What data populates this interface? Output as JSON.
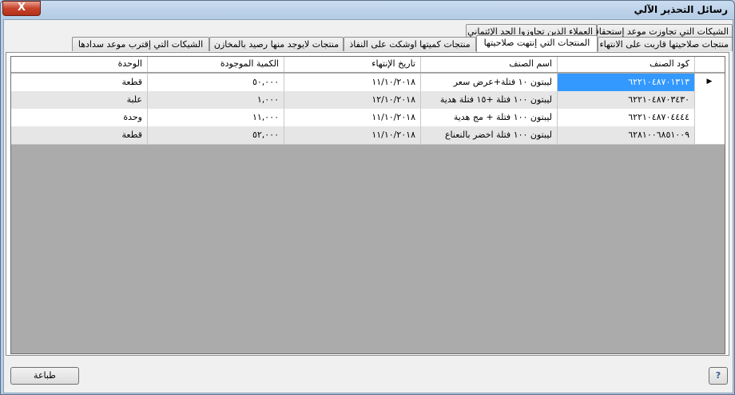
{
  "window": {
    "title": "رسائل التحذير الآلي",
    "close_label": "X"
  },
  "tabs_back": [
    {
      "label": "الشيكات التي تجاوزت موعد إستحقاقها"
    },
    {
      "label": "العملاء الذين تجاوزوا الحد الإئتماني"
    }
  ],
  "tabs_front": [
    {
      "label": "منتجات صلاحيتها قاربت على الانتهاء"
    },
    {
      "label": "المنتجات التي إنتهت صلاحيتها",
      "active": true
    },
    {
      "label": "منتجات كميتها اوشكت على النفاذ"
    },
    {
      "label": "منتجات لايوجد منها رصيد بالمخازن"
    },
    {
      "label": "الشيكات التي إقترب موعد سدادها"
    }
  ],
  "grid": {
    "columns": [
      "كود الصنف",
      "اسم الصنف",
      "تاريخ الإنتهاء",
      "الكمية الموجودة",
      "الوحدة"
    ],
    "rows": [
      {
        "code": "٦٢٢١٠٤٨٧٠١٣١٣",
        "name": "ليبتون ١٠ فتلة+عرض سعر",
        "expiry": "١١/١٠/٢٠١٨",
        "qty": "٥٠,٠٠٠",
        "unit": "قطعة",
        "selected": true
      },
      {
        "code": "٦٢٢١٠٤٨٧٠٣٤٣٠",
        "name": "ليبتون ١٠٠ فتلة +١٥ فتلة هدية",
        "expiry": "١٢/١٠/٢٠١٨",
        "qty": "١,٠٠٠",
        "unit": "علبة"
      },
      {
        "code": "٦٢٢١٠٤٨٧٠٤٤٤٤",
        "name": "ليبتون ١٠٠ فتلة + مج هدية",
        "expiry": "١١/١٠/٢٠١٨",
        "qty": "١١,٠٠٠",
        "unit": "وحدة"
      },
      {
        "code": "٦٢٨١٠٠٦٨٥١٠٠٩",
        "name": "ليبتون ١٠٠ فتلة اخضر بالنعناع",
        "expiry": "١١/١٠/٢٠١٨",
        "qty": "٥٢,٠٠٠",
        "unit": "قطعة"
      }
    ]
  },
  "buttons": {
    "print": "طباعة",
    "help": "?"
  },
  "icons": {
    "row_pointer": "right-triangle-icon"
  }
}
